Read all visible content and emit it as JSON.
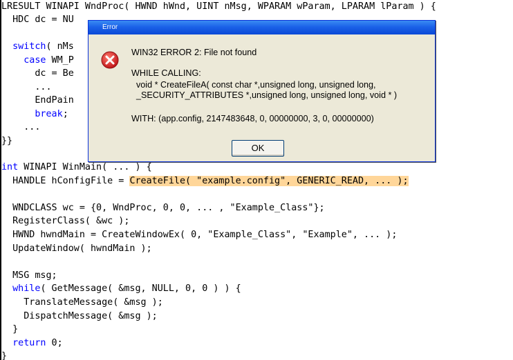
{
  "code_top": [
    [
      {
        "t": "LRESULT WINAPI WndProc( HWND hWnd, UINT nMsg, WPARAM wParam, LPARAM lParam ) {"
      }
    ],
    [
      {
        "t": "  HDC dc = NU"
      }
    ],
    [],
    [
      {
        "t": "  "
      },
      {
        "t": "switch",
        "c": "kw"
      },
      {
        "t": "( nMs"
      }
    ],
    [
      {
        "t": "    "
      },
      {
        "t": "case",
        "c": "kw"
      },
      {
        "t": " WM_P"
      }
    ],
    [
      {
        "t": "      dc = Be"
      }
    ],
    [
      {
        "t": "      ..."
      }
    ],
    [
      {
        "t": "      EndPain"
      }
    ],
    [
      {
        "t": "      "
      },
      {
        "t": "break",
        "c": "kw"
      },
      {
        "t": ";"
      }
    ],
    [
      {
        "t": "    ..."
      }
    ],
    [
      {
        "t": "}}"
      }
    ]
  ],
  "code_main": [
    [
      {
        "t": "int",
        "c": "kw"
      },
      {
        "t": " WINAPI WinMain( ... ) {"
      }
    ],
    [
      {
        "t": "  HANDLE hConfigFile = "
      },
      {
        "t": "CreateFile( \"example.config\", GENERIC_READ, ... );",
        "c": "hl"
      }
    ],
    [],
    [
      {
        "t": "  WNDCLASS wc = {0, WndProc, 0, 0, ... , \"Example_Class\"};"
      }
    ],
    [
      {
        "t": "  RegisterClass( &wc );"
      }
    ],
    [
      {
        "t": "  HWND hwndMain = CreateWindowEx( 0, \"Example_Class\", \"Example\", ... );"
      }
    ],
    [
      {
        "t": "  UpdateWindow( hwndMain );"
      }
    ],
    [],
    [
      {
        "t": "  MSG msg;"
      }
    ],
    [
      {
        "t": "  "
      },
      {
        "t": "while",
        "c": "kw"
      },
      {
        "t": "( GetMessage( &msg, NULL, 0, 0 ) ) {"
      }
    ],
    [
      {
        "t": "    TranslateMessage( &msg );"
      }
    ],
    [
      {
        "t": "    DispatchMessage( &msg );"
      }
    ],
    [
      {
        "t": "  }"
      }
    ],
    [
      {
        "t": "  "
      },
      {
        "t": "return",
        "c": "kw"
      },
      {
        "t": " 0;"
      }
    ],
    [
      {
        "t": "}"
      }
    ]
  ],
  "dialog": {
    "title": "Error",
    "icon": "error-x-icon",
    "heading": "WIN32 ERROR 2: File not found",
    "calling_label": "WHILE CALLING:",
    "calling_line1": "  void * CreateFileA( const char *,unsigned long, unsigned long,",
    "calling_line2": "  _SECURITY_ATTRIBUTES *,unsigned long, unsigned long, void * )",
    "with_line": "WITH: (app.config, 2147483648, 0, 00000000, 3, 0, 00000000)",
    "ok_label": "OK"
  },
  "colors": {
    "keyword": "#0000ff",
    "highlight": "#ffd699",
    "title_bar": "#1b61e8",
    "error_icon": "#d21c1c"
  }
}
